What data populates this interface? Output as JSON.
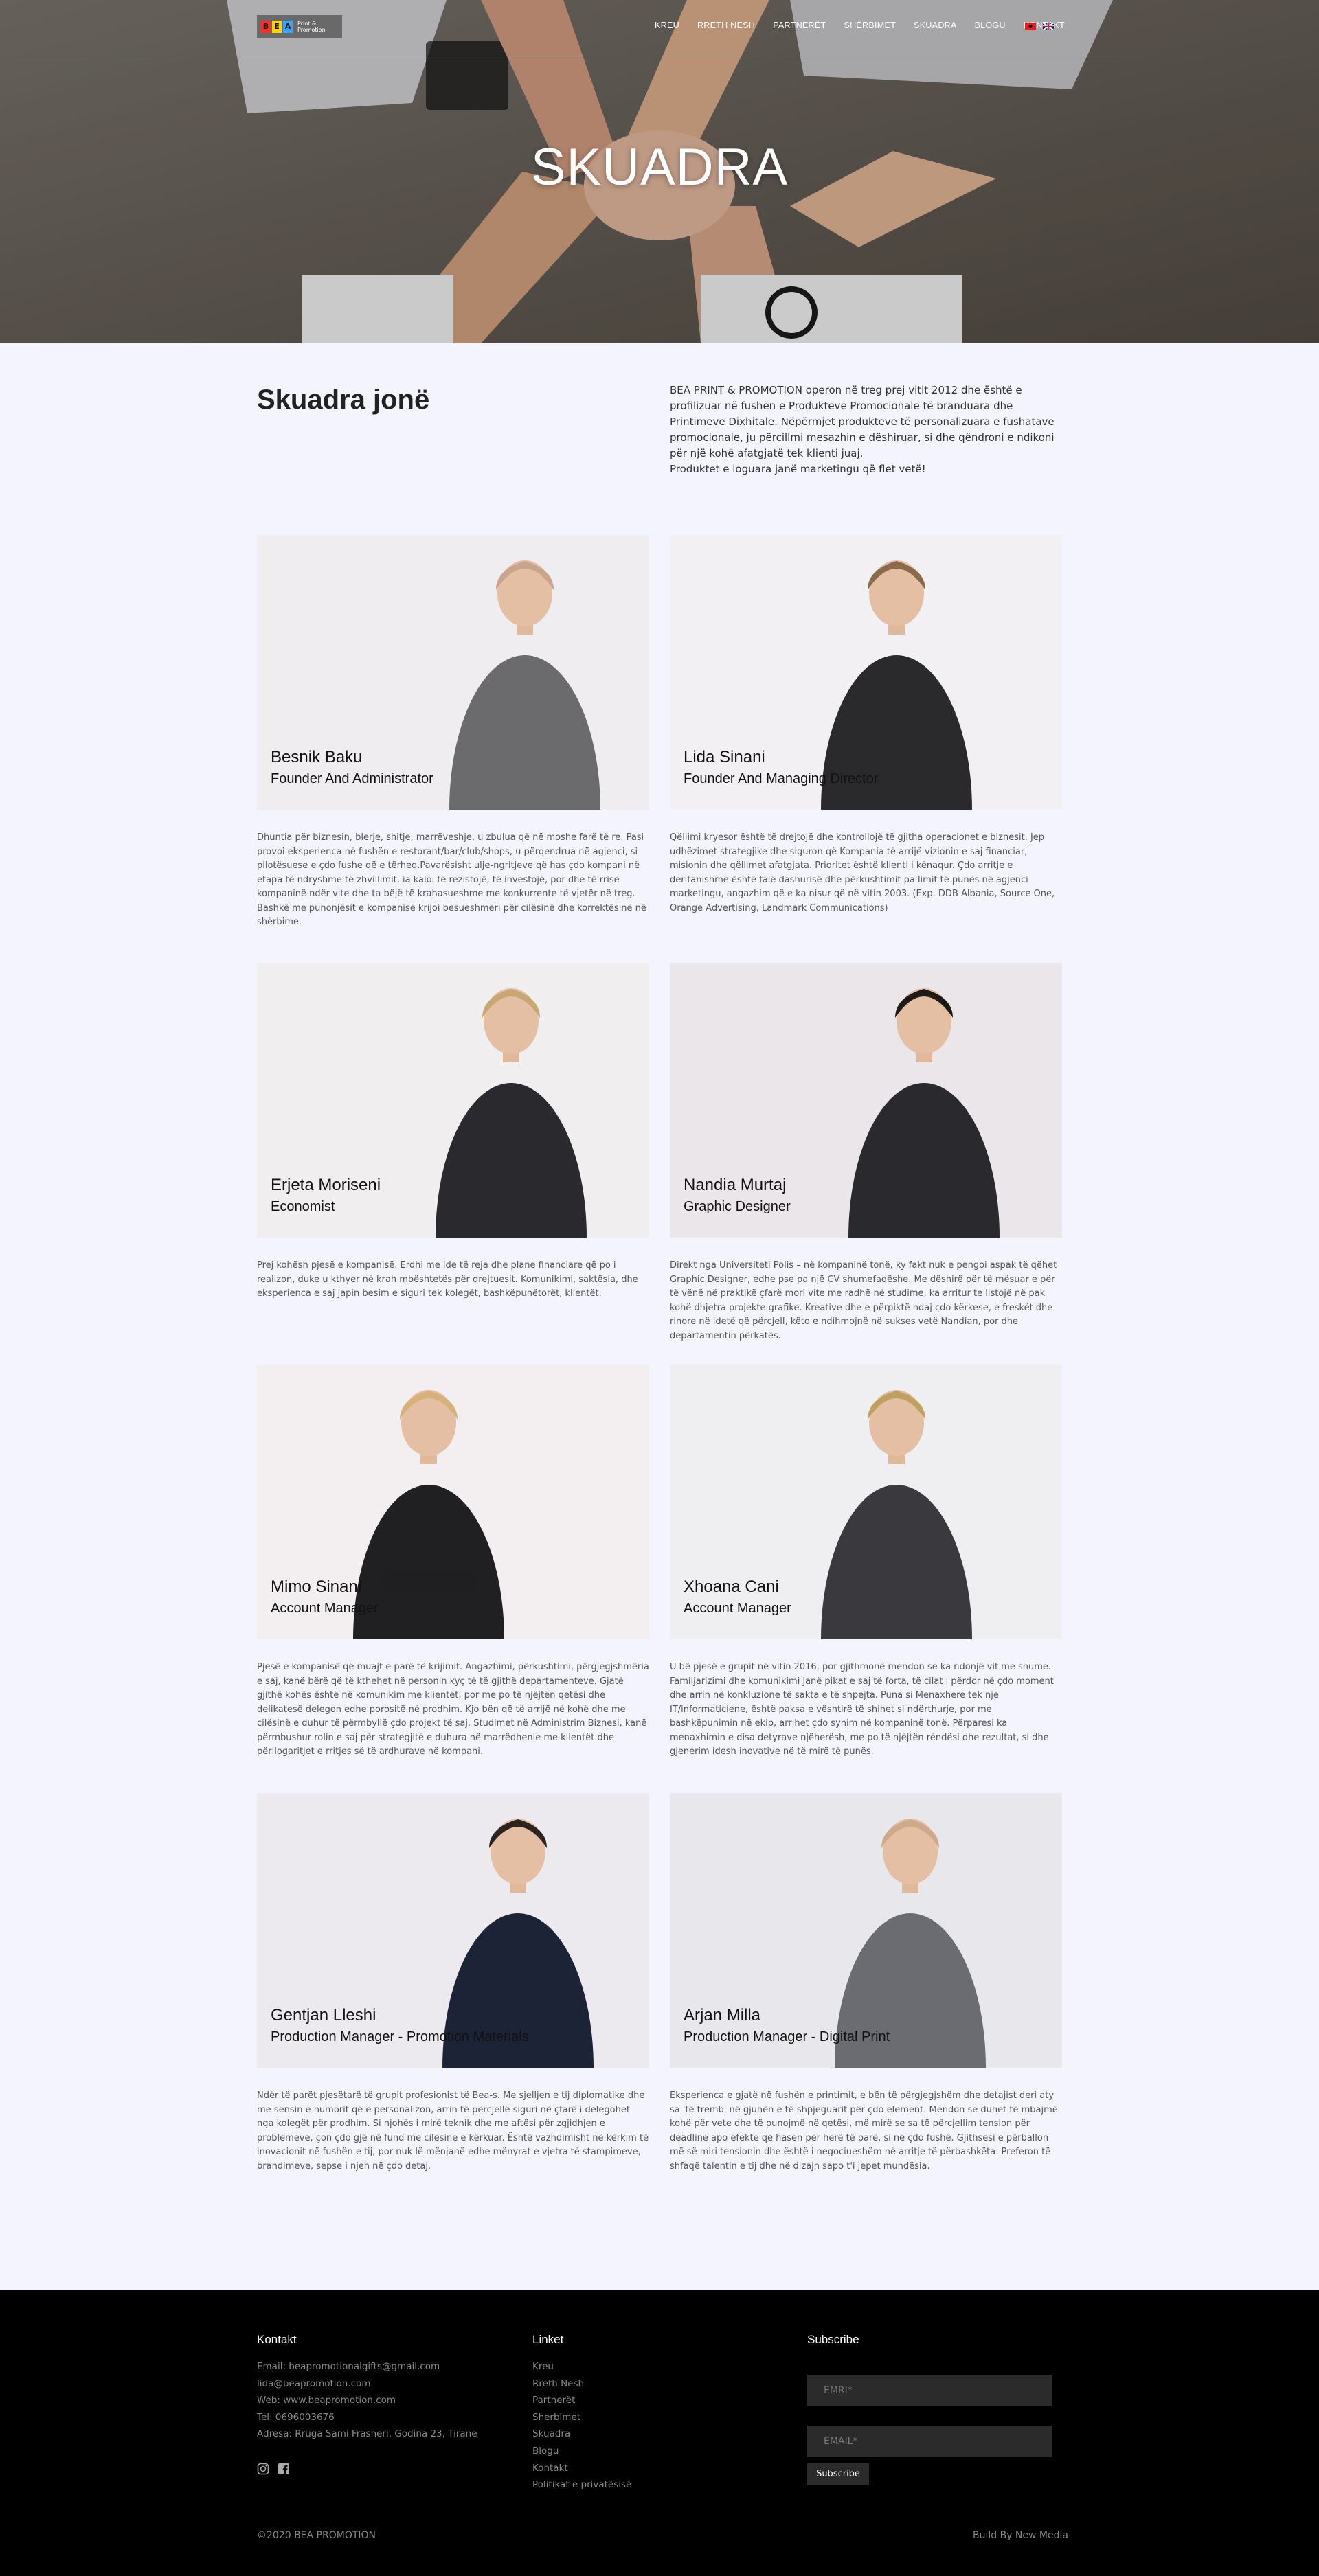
{
  "nav": {
    "logo_letters": [
      "B",
      "E",
      "A"
    ],
    "logo_sub": "Print & Promotion",
    "items": [
      "KREU",
      "RRETH NESH",
      "PARTNERËT",
      "SHËRBIMET",
      "SKUADRA",
      "BLOGU",
      "KONTAKT"
    ]
  },
  "hero": {
    "title": "SKUADRA"
  },
  "intro": {
    "heading": "Skuadra jonë",
    "text": "BEA PRINT & PROMOTION operon në treg prej vitit 2012 dhe është e profilizuar në fushën e Produkteve Promocionale të branduara dhe Printimeve Dixhitale. Nëpërmjet produkteve të personalizuara e fushatave promocionale, ju përcillmi mesazhin e dëshiruar, si dhe qëndroni e ndikoni për një kohë afatgjatë tek klienti juaj.",
    "text2": "Produktet e loguara janë marketingu që flet vetë!"
  },
  "team": [
    {
      "name": "Besnik Baku",
      "role": "Founder And Administrator",
      "bio": "Dhuntia për biznesin, blerje, shitje, marrëveshje, u zbulua që në moshe farë të re. Pasi provoi eksperienca në fushën e restorant/bar/club/shops, u përqendrua në agjenci, si pilotësuese e çdo fushe që e tërheq.Pavarësisht ulje-ngritjeve që has çdo kompani në etapa të ndryshme të zhvillimit, ia kaloi të rezistojë, të investojë, por dhe të rrisë kompaninë ndër vite dhe ta bëjë të krahasueshme me konkurrente të vjetër në treg. Bashkë me punonjësit e kompanisë krijoi besueshmëri për cilësinë dhe korrektësinë në shërbime."
    },
    {
      "name": "Lida Sinani",
      "role": "Founder And Managing Director",
      "bio": "Qëllimi kryesor është të drejtojë dhe kontrollojë të gjitha operacionet e biznesit. Jep udhëzimet strategjike dhe siguron që Kompania të arrijë vizionin e saj financiar, misionin dhe qëllimet afatgjata. Prioritet është klienti i kënaqur. Çdo arritje e deritanishme është falë dashurisë dhe përkushtimit pa limit të punës në agjenci marketingu, angazhim që e ka nisur që në vitin 2003. (Exp. DDB Albania, Source One, Orange Advertising, Landmark Communications)"
    },
    {
      "name": "Erjeta Moriseni",
      "role": "Economist",
      "bio": "Prej kohësh pjesë e kompanisë. Erdhi me ide të reja dhe plane financiare që po i realizon, duke u kthyer në krah mbështetës për drejtuesit. Komunikimi, saktësia, dhe eksperienca e saj japin besim e siguri tek kolegët, bashkëpunëtorët, klientët."
    },
    {
      "name": "Nandia Murtaj",
      "role": "Graphic Designer",
      "bio": "Direkt nga Universiteti Polis – në kompaninë tonë, ky fakt nuk e pengoi aspak të qëhet Graphic Designer, edhe pse pa një CV shumefaqëshe. Me dëshirë për të mësuar e për të vënë në praktikë çfarë mori vite me radhë në studime, ka arritur te listojë në pak kohë dhjetra projekte grafike. Kreative dhe e përpiktë ndaj çdo kërkese, e freskët dhe rinore në idetë që përcjell, këto e ndihmojnë në sukses vetë Nandian, por dhe departamentin përkatës."
    },
    {
      "name": "Mimo Sinani",
      "role": "Account Manager",
      "bio": "Pjesë e kompanisë që muajt e parë të krijimit. Angazhimi, përkushtimi, përgjegjshmëria e saj, kanë bërë që të kthehet në personin kyç të të gjithë departamenteve. Gjatë gjithë kohës është në komunikim me klientët, por me po të njëjtën qetësi dhe delikatesë delegon edhe porositë në prodhim. Kjo bën që të arrijë në kohë dhe me cilësinë e duhur të përmbyllë çdo projekt të saj. Studimet në Administrim Biznesi, kanë përmbushur rolin e saj për strategjitë e duhura në marrëdhenie me klientët dhe përllogaritjet e rritjes së të ardhurave në kompani."
    },
    {
      "name": "Xhoana Cani",
      "role": "Account Manager",
      "bio": "U bë pjesë e grupit në vitin 2016, por gjithmonë mendon se ka ndonjë vit me shume. Familjarizimi dhe komunikimi janë pikat e saj të forta, të cilat i përdor në çdo moment dhe arrin në konkluzione të sakta e të shpejta. Puna si Menaxhere tek një IT/informaticiene, është paksa e vështirë të shihet si ndërthurje, por me bashkëpunimin në ekip, arrihet çdo synim në kompaninë tonë. Përparesi ka menaxhimin e disa detyrave njëherësh, me po të njëjtën rëndësi dhe rezultat, si dhe gjenerim idesh inovative në të mirë të punës."
    },
    {
      "name": "Gentjan Lleshi",
      "role": "Production Manager - Promotion Materials",
      "bio": "Ndër të parët pjesëtarë të grupit profesionist të Bea-s. Me sjelljen e tij diplomatike dhe me sensin e humorit që e personalizon, arrin të përcjellë siguri në çfarë i delegohet nga kolegët për prodhim. Si njohës i mirë teknik dhe me aftësi për zgjidhjen e problemeve, çon çdo gjë në fund me cilësine e kërkuar. Është vazhdimisht në kërkim të inovacionit në fushën e tij, por nuk lë mënjanë edhe mënyrat e vjetra të stampimeve, brandimeve, sepse i njeh në çdo detaj."
    },
    {
      "name": "Arjan Milla",
      "role": "Production Manager - Digital Print",
      "bio": "Eksperienca e gjatë në fushën e printimit, e bën të përgjegjshëm dhe detajist deri aty sa 'të tremb' në gjuhën e të shpjeguarit për çdo element. Mendon se duhet të mbajmë kohë për vete dhe të punojmë në qetësi, më mirë se sa të përcjellim tension për deadline apo efekte që hasen për herë të parë, si në çdo fushë. Gjithsesi e përballon më së miri tensionin dhe është i negociueshëm në arritje të përbashkëta. Preferon të shfaqë talentin e tij dhe në dizajn sapo t'i jepet mundësia."
    }
  ],
  "footer": {
    "contact_title": "Kontakt",
    "contact": [
      "Email: beapromotionalgifts@gmail.com",
      "lida@beapromotion.com",
      "Web: www.beapromotion.com",
      "Tel: 0696003676",
      "Adresa: Rruga Sami Frasheri, Godina 23, Tirane"
    ],
    "links_title": "Linket",
    "links": [
      "Kreu",
      "Rreth Nesh",
      "Partnerët",
      "Sherbimet",
      "Skuadra",
      "Blogu",
      "Kontakt",
      "Politikat e privatësisë"
    ],
    "subscribe_title": "Subscribe",
    "name_placeholder": "EMRI*",
    "email_placeholder": "EMAIL*",
    "subscribe_button": "Subscribe",
    "copyright": "©2020 BEA PROMOTION",
    "credit": "Build By New Media"
  },
  "colors": {
    "logo": [
      "#ff2c2c",
      "#ffd200",
      "#35a7ff"
    ],
    "background": "#f4f4fe",
    "footer": "#000000"
  }
}
